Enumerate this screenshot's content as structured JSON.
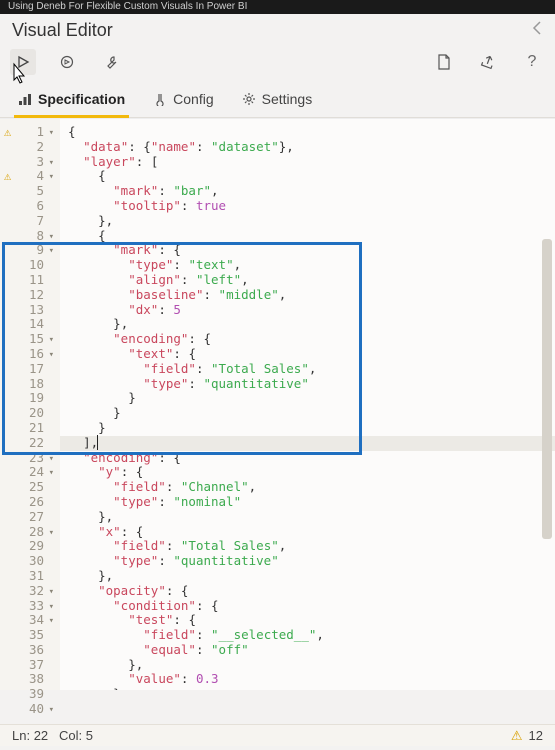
{
  "video_title": "Using Deneb For Flexible Custom Visuals In Power BI",
  "header": {
    "title": "Visual Editor"
  },
  "toolbar": {
    "play": "play-icon",
    "refresh": "refresh-icon",
    "wrench": "wrench-icon",
    "doc": "document-icon",
    "share": "share-icon",
    "help": "help-icon"
  },
  "tabs": {
    "spec": "Specification",
    "config": "Config",
    "settings": "Settings"
  },
  "code": {
    "lines": [
      {
        "n": 1,
        "fold": "▾",
        "warn": true,
        "raw": "{"
      },
      {
        "n": 2,
        "raw": "  \"data\": {\"name\": \"dataset\"},"
      },
      {
        "n": 3,
        "fold": "▾",
        "raw": "  \"layer\": ["
      },
      {
        "n": 4,
        "fold": "▾",
        "warn": true,
        "raw": "    {"
      },
      {
        "n": 5,
        "raw": "      \"mark\": \"bar\","
      },
      {
        "n": 6,
        "raw": "      \"tooltip\": true"
      },
      {
        "n": 7,
        "raw": "    },"
      },
      {
        "n": 8,
        "fold": "▾",
        "raw": "    {"
      },
      {
        "n": 9,
        "fold": "▾",
        "raw": "      \"mark\": {"
      },
      {
        "n": 10,
        "raw": "        \"type\": \"text\","
      },
      {
        "n": 11,
        "raw": "        \"align\": \"left\","
      },
      {
        "n": 12,
        "raw": "        \"baseline\": \"middle\","
      },
      {
        "n": 13,
        "raw": "        \"dx\": 5"
      },
      {
        "n": 14,
        "raw": "      },"
      },
      {
        "n": 15,
        "fold": "▾",
        "raw": "      \"encoding\": {"
      },
      {
        "n": 16,
        "fold": "▾",
        "raw": "        \"text\": {"
      },
      {
        "n": 17,
        "raw": "          \"field\": \"Total Sales\","
      },
      {
        "n": 18,
        "raw": "          \"type\": \"quantitative\""
      },
      {
        "n": 19,
        "raw": "        }"
      },
      {
        "n": 20,
        "raw": "      }"
      },
      {
        "n": 21,
        "raw": "    }"
      },
      {
        "n": 22,
        "cursor": true,
        "raw": "  ],"
      },
      {
        "n": 23,
        "fold": "▾",
        "raw": "  \"encoding\": {"
      },
      {
        "n": 24,
        "fold": "▾",
        "raw": "    \"y\": {"
      },
      {
        "n": 25,
        "raw": "      \"field\": \"Channel\","
      },
      {
        "n": 26,
        "raw": "      \"type\": \"nominal\""
      },
      {
        "n": 27,
        "raw": "    },"
      },
      {
        "n": 28,
        "fold": "▾",
        "raw": "    \"x\": {"
      },
      {
        "n": 29,
        "raw": "      \"field\": \"Total Sales\","
      },
      {
        "n": 30,
        "raw": "      \"type\": \"quantitative\""
      },
      {
        "n": 31,
        "raw": "    },"
      },
      {
        "n": 32,
        "fold": "▾",
        "raw": "    \"opacity\": {"
      },
      {
        "n": 33,
        "fold": "▾",
        "raw": "      \"condition\": {"
      },
      {
        "n": 34,
        "fold": "▾",
        "raw": "        \"test\": {"
      },
      {
        "n": 35,
        "raw": "          \"field\": \"__selected__\","
      },
      {
        "n": 36,
        "raw": "          \"equal\": \"off\""
      },
      {
        "n": 37,
        "raw": "        },"
      },
      {
        "n": 38,
        "raw": "        \"value\": 0.3"
      },
      {
        "n": 39,
        "raw": "      }"
      },
      {
        "n": 40,
        "fold": "▾",
        "raw": "    }"
      }
    ]
  },
  "status": {
    "ln_label": "Ln:",
    "ln": "22",
    "col_label": "Col:",
    "col": "5",
    "warn_count": "12"
  }
}
